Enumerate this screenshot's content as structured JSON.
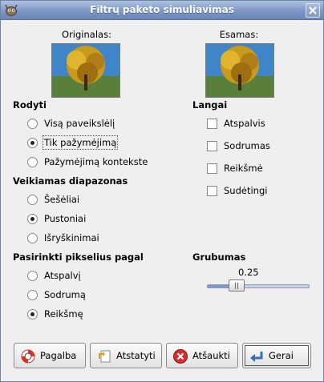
{
  "window": {
    "title": "Filtrų paketo simuliavimas"
  },
  "previews": {
    "original_label": "Originalas:",
    "current_label": "Esamas:"
  },
  "rodyti": {
    "heading": "Rodyti",
    "options": [
      {
        "label": "Visą paveikslėlį",
        "selected": false
      },
      {
        "label": "Tik pažymėjimą",
        "selected": true
      },
      {
        "label": "Pažymėjimą kontekste",
        "selected": false
      }
    ]
  },
  "diapazonas": {
    "heading": "Veikiamas diapazonas",
    "options": [
      {
        "label": "Šešėliai",
        "selected": false
      },
      {
        "label": "Pustoniai",
        "selected": true
      },
      {
        "label": "Išryškinimai",
        "selected": false
      }
    ]
  },
  "pikseliai": {
    "heading": "Pasirinkti pikselius pagal",
    "options": [
      {
        "label": "Atspalvį",
        "selected": false
      },
      {
        "label": "Sodrumą",
        "selected": false
      },
      {
        "label": "Reikšmę",
        "selected": true
      }
    ]
  },
  "langai": {
    "heading": "Langai",
    "options": [
      {
        "label": "Atspalvis",
        "checked": false
      },
      {
        "label": "Sodrumas",
        "checked": false
      },
      {
        "label": "Reikšmė",
        "checked": false
      },
      {
        "label": "Sudėtingi",
        "checked": false
      }
    ]
  },
  "grubumas": {
    "heading": "Grubumas",
    "value": "0.25",
    "fraction": 0.25
  },
  "buttons": {
    "help": "Pagalba",
    "reset": "Atstatyti",
    "cancel": "Atšaukti",
    "ok": "Gerai"
  }
}
